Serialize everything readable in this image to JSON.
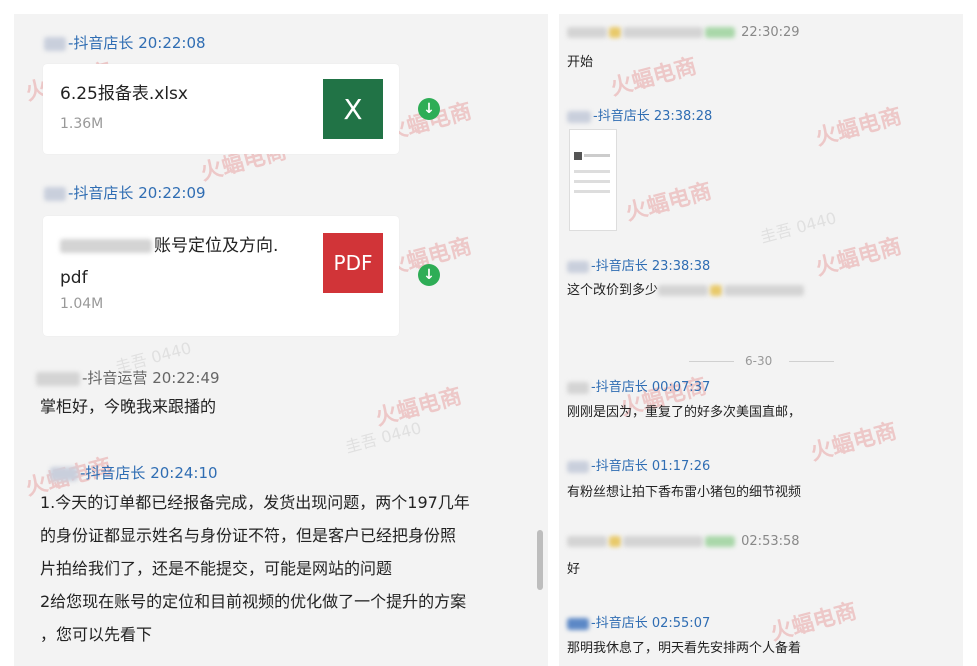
{
  "left": {
    "messages": [
      {
        "sender": "-抖音店长",
        "time": "20:22:08",
        "file": {
          "name": "6.25报备表.xlsx",
          "size": "1.36M",
          "icon": "X",
          "icon_color": "#217346"
        }
      },
      {
        "sender": "-抖音店长",
        "time": "20:22:09",
        "file": {
          "name_line1": "账号定位及方向.",
          "name_line2": "pdf",
          "size": "1.04M",
          "icon": "PDF",
          "icon_color": "#d13438"
        }
      },
      {
        "sender": "-抖音运营",
        "time": "20:22:49",
        "text": "掌柜好，今晚我来跟播的"
      },
      {
        "sender": "-抖音店长",
        "time": "20:24:10",
        "lines": [
          "1.今天的订单都已经报备完成，发货出现问题，两个197几年",
          "的身份证都显示姓名与身份证不符，但是客户已经把身份照",
          "片拍给我们了，还是不能提交，可能是网站的问题",
          "2给您现在账号的定位和目前视频的优化做了一个提升的方案",
          "，您可以先看下"
        ]
      }
    ]
  },
  "right": {
    "messages": [
      {
        "sender": "",
        "time": "22:30:29",
        "text": "开始"
      },
      {
        "sender": "-抖音店长",
        "time": "23:38:28",
        "image": true
      },
      {
        "sender": "-抖音店长",
        "time": "23:38:38",
        "text": "这个改价到多少"
      },
      {
        "divider": "6-30"
      },
      {
        "sender": "-抖音店长",
        "time": "00:07:37",
        "text": "刚刚是因为，重复了的好多次美国直邮，"
      },
      {
        "sender": "-抖音店长",
        "time": "01:17:26",
        "text": "有粉丝想让拍下香布雷小猪包的细节视频"
      },
      {
        "sender": "",
        "time": "02:53:58",
        "text": "好"
      },
      {
        "sender": "-抖音店长",
        "time": "02:55:07",
        "text": "那明我休息了，明天看先安排两个人备着"
      }
    ]
  },
  "watermark": {
    "brand": "火蝠电商",
    "code": "圭吾 0440"
  }
}
